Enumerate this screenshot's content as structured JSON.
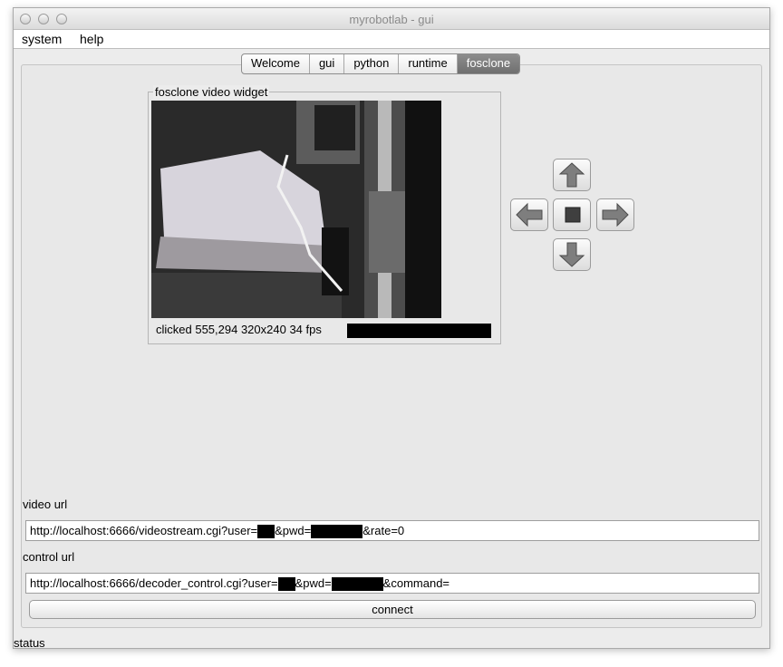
{
  "window": {
    "title": "myrobotlab - gui"
  },
  "menu": {
    "items": [
      "system",
      "help"
    ]
  },
  "tabs": [
    {
      "label": "Welcome"
    },
    {
      "label": "gui"
    },
    {
      "label": "python"
    },
    {
      "label": "runtime"
    },
    {
      "label": "fosclone",
      "active": true
    }
  ],
  "video_widget": {
    "legend": "fosclone  video widget",
    "status": "clicked 555,294 320x240 34 fps"
  },
  "controls": {
    "up": "up-arrow-icon",
    "left": "left-arrow-icon",
    "stop": "stop-square-icon",
    "right": "right-arrow-icon",
    "down": "down-arrow-icon"
  },
  "video_url": {
    "label": "video url",
    "prefix": "http://localhost:6666/videostream.cgi?user=",
    "mid": "&pwd=",
    "suffix": "&rate=0"
  },
  "control_url": {
    "label": "control url",
    "prefix": "http://localhost:6666/decoder_control.cgi?user=",
    "mid": "&pwd=",
    "suffix": "&command="
  },
  "connect_label": "connect",
  "status_label": "status"
}
